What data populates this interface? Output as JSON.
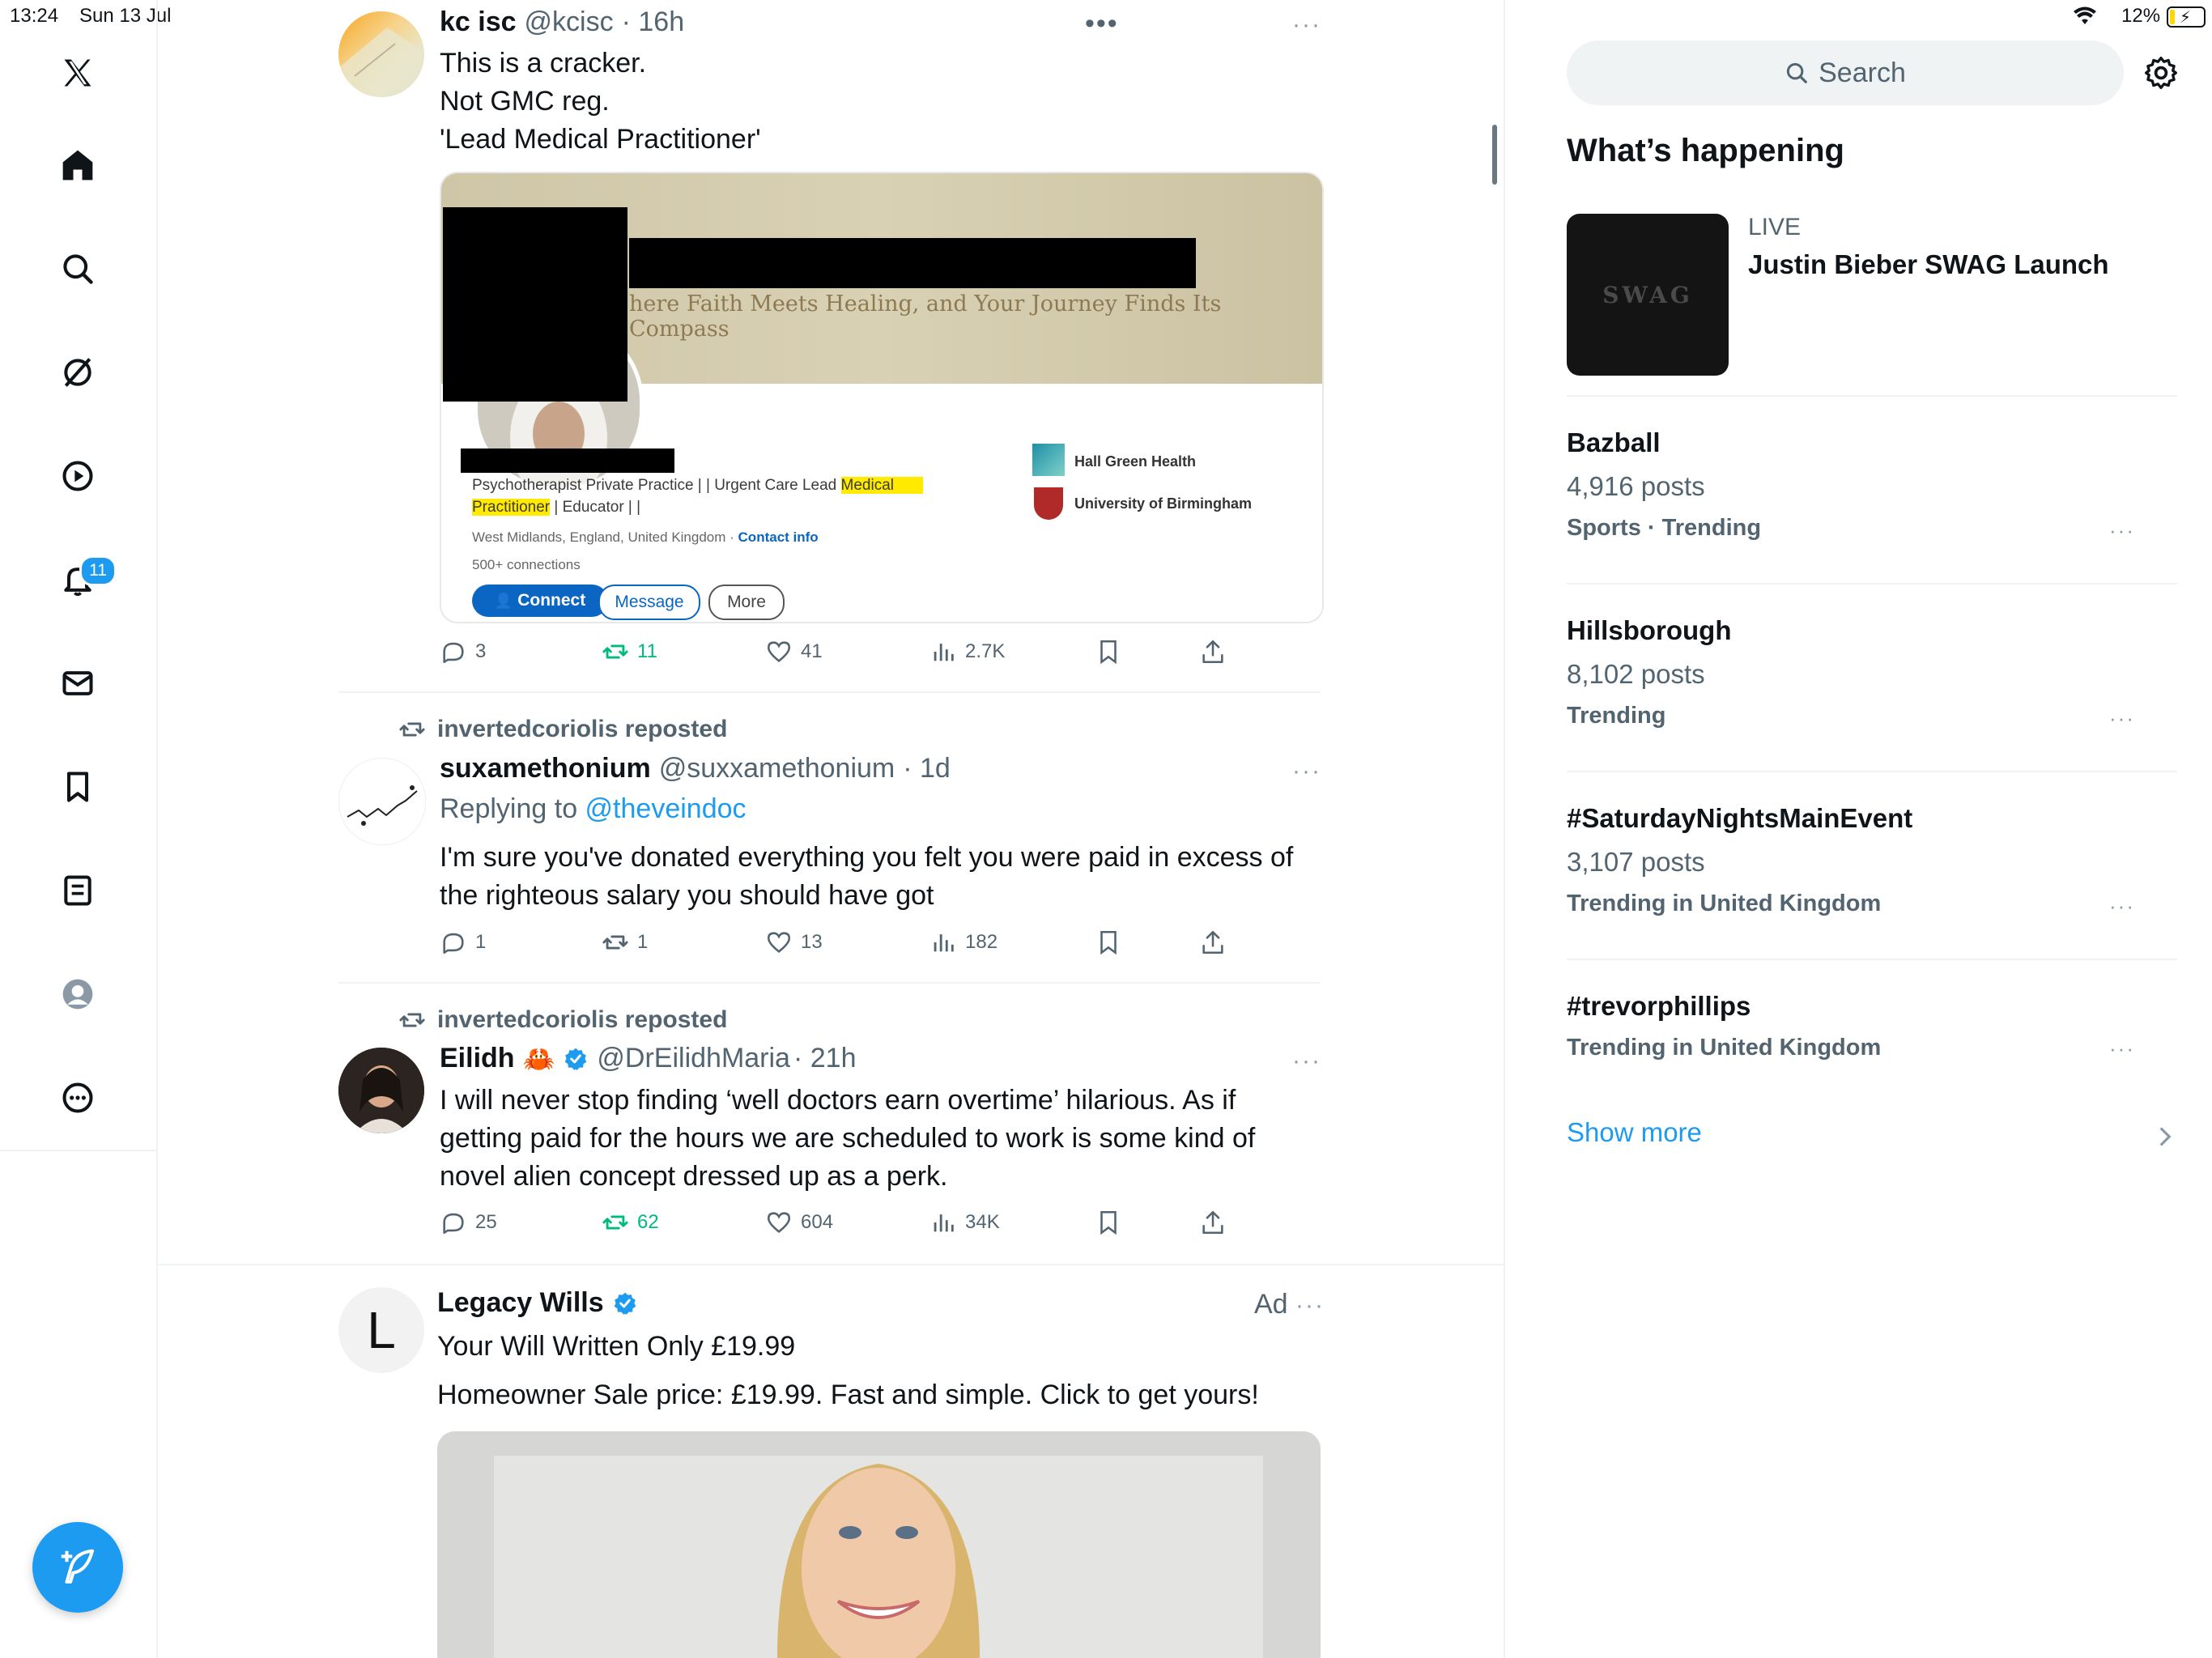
{
  "status_bar": {
    "time": "13:24",
    "date": "Sun 13 Jul",
    "battery": "12%"
  },
  "nav": {
    "items": [
      "x-logo-icon",
      "home-icon",
      "search-icon",
      "grok-icon",
      "video-icon",
      "notifications-icon",
      "messages-icon",
      "bookmarks-icon",
      "lists-icon",
      "profile-icon",
      "more-icon"
    ],
    "notifications_badge": "11"
  },
  "feed": {
    "tweet1": {
      "name": "kc isc",
      "handle": "@kcisc",
      "time": "· 16h",
      "lines": [
        "This is a cracker.",
        "Not GMC reg.",
        "'Lead Medical Practitioner'"
      ],
      "embed": {
        "banner_text": "here Faith Meets Healing, and Your Journey Finds Its Compass",
        "headline_a": "Psychotherapist Private Practice | | Urgent Care Lead ",
        "headline_hl1": "Medical",
        "headline_hl2": "Practitioner",
        "headline_b": " | Educator | |",
        "location": "West Midlands, England, United Kingdom · ",
        "contact": "Contact info",
        "connections": "500+ connections",
        "org1": "Hall Green Health",
        "org2": "University of Birmingham",
        "btn_connect": "Connect",
        "btn_message": "Message",
        "btn_more": "More"
      },
      "stats": {
        "replies": "3",
        "reposts": "11",
        "likes": "41",
        "views": "2.7K"
      }
    },
    "tweet2": {
      "reposted_by": "invertedcoriolis reposted",
      "name": "suxamethonium",
      "handle": "@suxxamethonium",
      "time": "· 1d",
      "replying_label": "Replying to ",
      "replying_to": "@theveindoc",
      "lines": [
        "I'm sure you've donated everything you felt you were paid in excess of",
        "the righteous salary you should have got"
      ],
      "stats": {
        "replies": "1",
        "reposts": "1",
        "likes": "13",
        "views": "182"
      }
    },
    "tweet3": {
      "reposted_by": "invertedcoriolis reposted",
      "name": "Eilidh",
      "emoji": "🦀",
      "handle": "@DrEilidhMaria",
      "time": "· 21h",
      "lines": [
        "I will never stop finding ‘well doctors earn overtime’ hilarious. As if",
        "getting paid for the hours we are scheduled to work is some kind of",
        "novel alien concept dressed up as a perk."
      ],
      "stats": {
        "replies": "25",
        "reposts": "62",
        "likes": "604",
        "views": "34K"
      }
    },
    "ad": {
      "avatar_letter": "L",
      "name": "Legacy Wills",
      "ad_label": "Ad",
      "headline": "Your Will Written Only £19.99",
      "body": "Homeowner Sale price: £19.99. Fast and simple. Click to get yours!"
    }
  },
  "sidebar": {
    "search_placeholder": "Search",
    "heading": "What’s happening",
    "live": {
      "label": "LIVE",
      "title": "Justin Bieber SWAG Launch",
      "thumb_text": "SWAG"
    },
    "trends": [
      {
        "title": "Bazball",
        "posts": "4,916 posts",
        "meta": "Sports · Trending"
      },
      {
        "title": "Hillsborough",
        "posts": "8,102 posts",
        "meta": "Trending"
      },
      {
        "title": "#SaturdayNightsMainEvent",
        "posts": "3,107 posts",
        "meta": "Trending in United Kingdom"
      },
      {
        "title": "#trevorphillips",
        "posts": "",
        "meta": "Trending in United Kingdom"
      }
    ],
    "show_more": "Show more"
  },
  "colors": {
    "accent": "#1d9bf0",
    "repost_green": "#00ba7c",
    "text": "#0f1419",
    "muted": "#536471",
    "highlight": "#ffea00"
  }
}
